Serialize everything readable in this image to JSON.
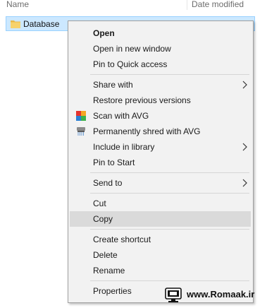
{
  "header": {
    "name_col": "Name",
    "date_col": "Date modified"
  },
  "file": {
    "name": "Database",
    "icon": "folder-icon"
  },
  "context_menu": {
    "open": "Open",
    "open_new_window": "Open in new window",
    "pin_quick_access": "Pin to Quick access",
    "share_with": "Share with",
    "restore_versions": "Restore previous versions",
    "scan_avg": "Scan with AVG",
    "shred_avg": "Permanently shred with AVG",
    "include_library": "Include in library",
    "pin_start": "Pin to Start",
    "send_to": "Send to",
    "cut": "Cut",
    "copy": "Copy",
    "create_shortcut": "Create shortcut",
    "delete": "Delete",
    "rename": "Rename",
    "properties": "Properties"
  },
  "footer": {
    "site": "www.Romaak.ir"
  },
  "colors": {
    "selection_bg": "#cce8ff",
    "menu_bg": "#f2f2f2",
    "menu_highlight": "#dadada"
  }
}
